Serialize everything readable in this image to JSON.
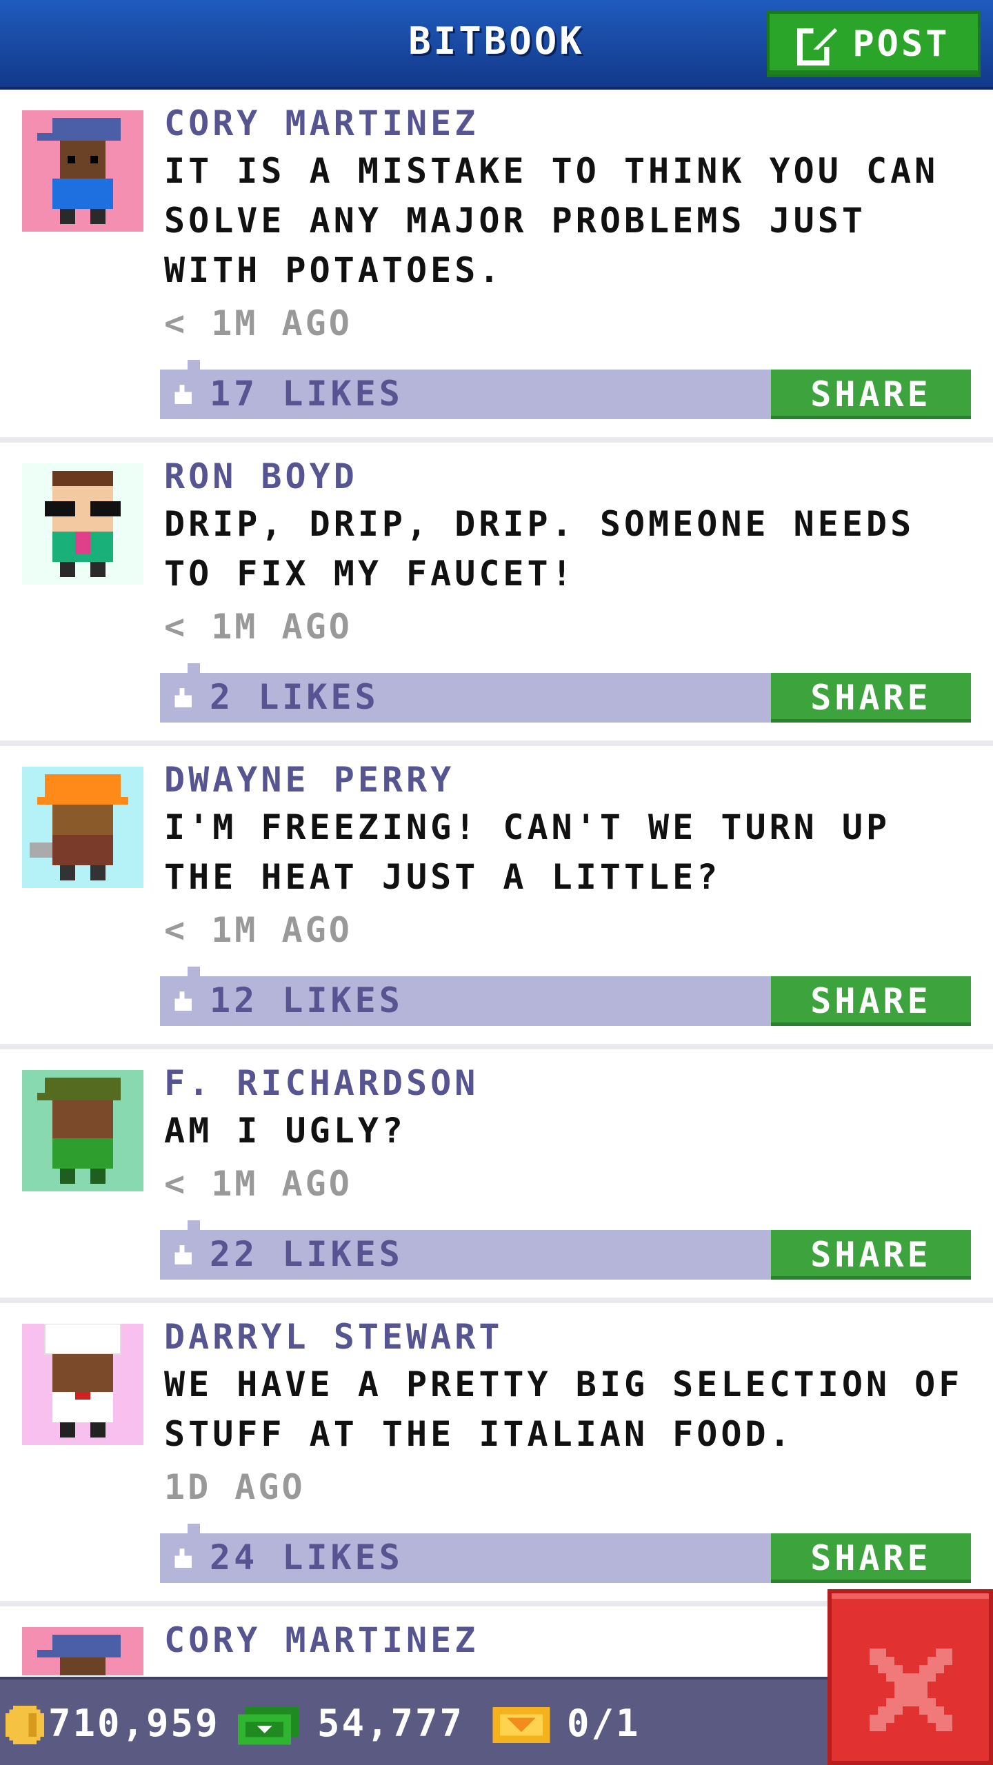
{
  "header": {
    "title": "BITBOOK",
    "post_label": "POST"
  },
  "posts": [
    {
      "author": "CORY MARTINEZ",
      "message": "IT IS A MISTAKE TO THINK YOU CAN SOLVE ANY MAJOR PROBLEMS JUST WITH POTATOES.",
      "time": "< 1M AGO",
      "likes": "17 LIKES",
      "share": "SHARE",
      "avatar_bg": "#f48fb1"
    },
    {
      "author": "RON BOYD",
      "message": "DRIP, DRIP, DRIP. SOMEONE NEEDS TO FIX MY FAUCET!",
      "time": "< 1M AGO",
      "likes": "2 LIKES",
      "share": "SHARE",
      "avatar_bg": "#eefff8"
    },
    {
      "author": "DWAYNE PERRY",
      "message": "I'M FREEZING! CAN'T WE TURN UP THE HEAT JUST A LITTLE?",
      "time": "< 1M AGO",
      "likes": "12 LIKES",
      "share": "SHARE",
      "avatar_bg": "#b5f2f7"
    },
    {
      "author": "F. RICHARDSON",
      "message": "AM I UGLY?",
      "time": "< 1M AGO",
      "likes": "22 LIKES",
      "share": "SHARE",
      "avatar_bg": "#88d8b0"
    },
    {
      "author": "DARRYL STEWART",
      "message": "WE HAVE A PRETTY BIG SELECTION OF STUFF AT THE ITALIAN FOOD.",
      "time": "1D AGO",
      "likes": "24 LIKES",
      "share": "SHARE",
      "avatar_bg": "#f7c0ef"
    },
    {
      "author": "CORY MARTINEZ",
      "avatar_bg": "#f48fb1"
    }
  ],
  "resources": {
    "coins": "710,959",
    "bux": "54,777",
    "tickets": "0/1"
  },
  "colors": {
    "header": "#1a4aa6",
    "share": "#3da43d",
    "likes_bar": "#b4b5d8",
    "author": "#565491",
    "close": "#e23131"
  },
  "icons": {
    "post": "edit-icon",
    "like": "thumb-up-icon",
    "close": "close-icon",
    "coin": "coin-icon",
    "bux": "cash-icon",
    "ticket": "ticket-icon"
  }
}
